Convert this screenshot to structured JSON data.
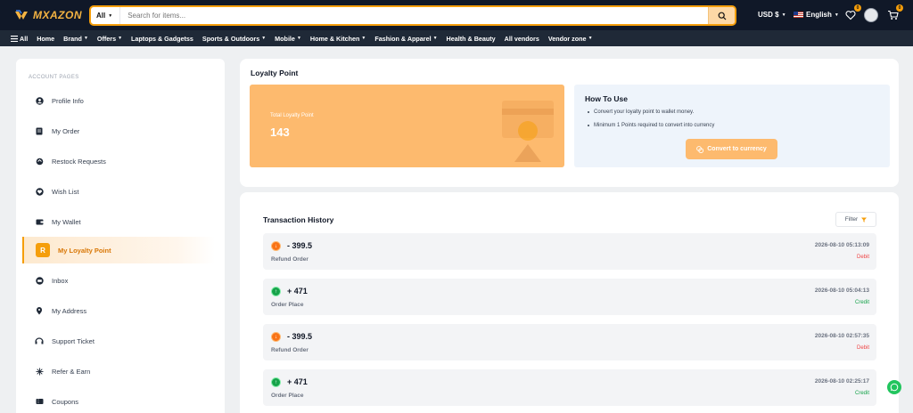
{
  "header": {
    "logo_text": "MXAZON",
    "search_category": "All",
    "search_placeholder": "Search for items...",
    "currency": "USD $",
    "language": "English",
    "wishlist_count": "0",
    "cart_count": "0"
  },
  "nav": {
    "items": [
      {
        "label": "All",
        "has_menu": false
      },
      {
        "label": "Home",
        "has_menu": false
      },
      {
        "label": "Brand",
        "has_menu": true
      },
      {
        "label": "Offers",
        "has_menu": true
      },
      {
        "label": "Laptops & Gadgetss",
        "has_menu": false
      },
      {
        "label": "Sports & Outdoors",
        "has_menu": true
      },
      {
        "label": "Mobile",
        "has_menu": true
      },
      {
        "label": "Home & Kitchen",
        "has_menu": true
      },
      {
        "label": "Fashion & Apparel",
        "has_menu": true
      },
      {
        "label": "Health & Beauty",
        "has_menu": false
      },
      {
        "label": "All vendors",
        "has_menu": false
      },
      {
        "label": "Vendor zone",
        "has_menu": true
      }
    ]
  },
  "sidebar": {
    "title": "ACCOUNT PAGES",
    "items": [
      {
        "label": "Profile Info",
        "icon": "user-icon"
      },
      {
        "label": "My Order",
        "icon": "order-icon"
      },
      {
        "label": "Restock Requests",
        "icon": "restock-icon"
      },
      {
        "label": "Wish List",
        "icon": "heart-icon"
      },
      {
        "label": "My Wallet",
        "icon": "wallet-icon"
      },
      {
        "label": "My Loyalty Point",
        "icon": "loyalty-icon",
        "active": true,
        "icon_letter": "R"
      },
      {
        "label": "Inbox",
        "icon": "inbox-icon"
      },
      {
        "label": "My Address",
        "icon": "location-icon"
      },
      {
        "label": "Support Ticket",
        "icon": "ticket-icon"
      },
      {
        "label": "Refer & Earn",
        "icon": "refer-icon"
      },
      {
        "label": "Coupons",
        "icon": "coupon-icon"
      }
    ]
  },
  "loyalty": {
    "title": "Loyalty Point",
    "total_label": "Total Loyalty Point",
    "total_value": "143",
    "how_to_title": "How To Use",
    "how_to_items": [
      "Convert your loyalty point to wallet money.",
      "Minimum 1 Points required to convert into currency"
    ],
    "convert_label": "Convert to currency"
  },
  "transactions": {
    "title": "Transaction History",
    "filter_label": "Filter",
    "rows": [
      {
        "amount": "- 399.5",
        "type": "Refund Order",
        "date": "2026-08-10 05:13:09",
        "status": "Debit",
        "kind": "debit"
      },
      {
        "amount": "+ 471",
        "type": "Order Place",
        "date": "2026-08-10 05:04:13",
        "status": "Credit",
        "kind": "credit"
      },
      {
        "amount": "- 399.5",
        "type": "Refund Order",
        "date": "2026-08-10 02:57:35",
        "status": "Debit",
        "kind": "debit"
      },
      {
        "amount": "+ 471",
        "type": "Order Place",
        "date": "2026-08-10 02:25:17",
        "status": "Credit",
        "kind": "credit"
      }
    ]
  },
  "colors": {
    "accent": "#f59e0b",
    "header_bg": "#101828",
    "nav_bg": "#1f2937",
    "loyalty_card": "#fdba6e",
    "debit": "#ef4444",
    "credit": "#16a34a"
  }
}
